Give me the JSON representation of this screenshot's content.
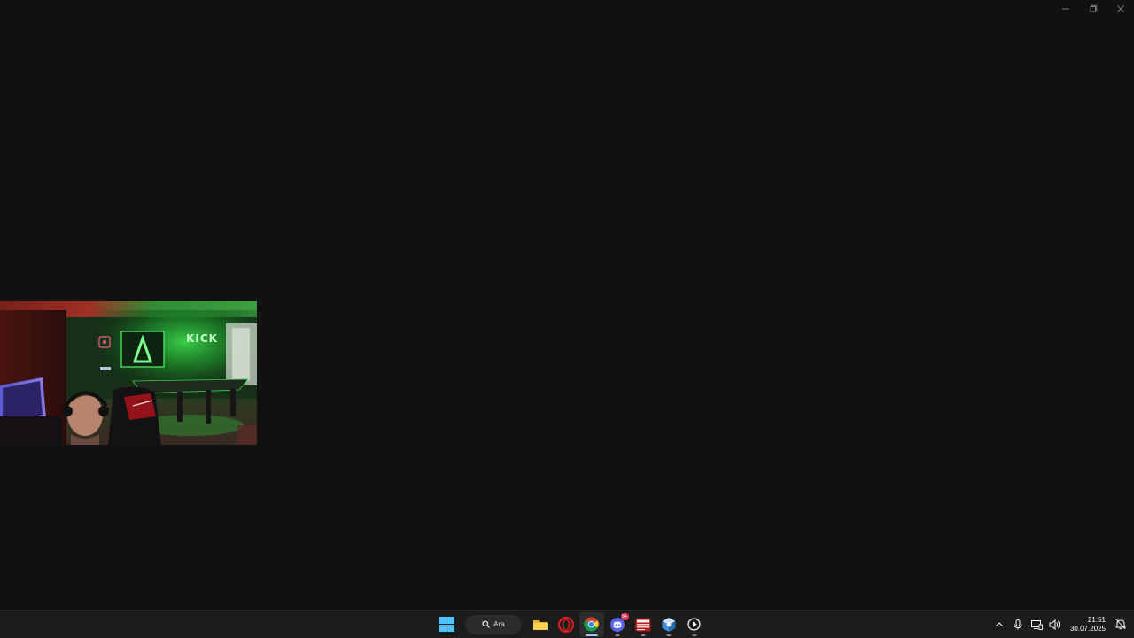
{
  "window_controls": {
    "minimize_icon": "minimize-icon",
    "restore_icon": "restore-icon",
    "close_icon": "close-icon"
  },
  "webcam": {
    "neon_sign_text": "KICK"
  },
  "taskbar": {
    "search_label": "Ara",
    "apps": [
      {
        "name": "start",
        "icon": "windows-start-icon"
      },
      {
        "name": "file-explorer",
        "icon": "folder-icon"
      },
      {
        "name": "opera",
        "icon": "opera-icon"
      },
      {
        "name": "chrome",
        "icon": "chrome-icon",
        "active": true
      },
      {
        "name": "discord",
        "icon": "discord-icon",
        "badge": "9+"
      },
      {
        "name": "app-red",
        "icon": "red-app-icon"
      },
      {
        "name": "app-cube",
        "icon": "cube-app-icon"
      },
      {
        "name": "media-player",
        "icon": "play-icon"
      }
    ],
    "tray": {
      "show_hidden_icon": "chevron-up-icon",
      "mic_icon": "microphone-icon",
      "network_icon": "network-icon",
      "volume_icon": "volume-icon",
      "notification_icon": "notification-icon"
    },
    "clock": {
      "time": "21:51",
      "date": "30.07.2025"
    }
  },
  "colors": {
    "desktop_bg": "#111111",
    "taskbar_bg": "#1c1c1c",
    "neon_green": "#3cff5a",
    "active_indicator": "#9ec5ff",
    "badge": "#e0375a"
  }
}
